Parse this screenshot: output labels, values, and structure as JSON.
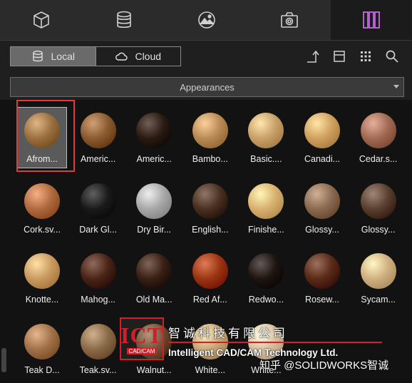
{
  "top_tabs": [
    {
      "name": "tab-parts",
      "icon": "cube-icon"
    },
    {
      "name": "tab-database",
      "icon": "database-icon"
    },
    {
      "name": "tab-environments",
      "icon": "landscape-icon"
    },
    {
      "name": "tab-camera",
      "icon": "camera-icon"
    },
    {
      "name": "tab-appearances",
      "icon": "columns-icon",
      "active": true
    }
  ],
  "source_toggle": {
    "local": "Local",
    "cloud": "Cloud",
    "selected": "Local"
  },
  "toolbar_icons": [
    "up-level-icon",
    "list-view-icon",
    "grid-view-icon",
    "search-icon"
  ],
  "dropdown": {
    "value": "Appearances"
  },
  "items": [
    {
      "label": "Afrom...",
      "color": "#9a7040",
      "selected": true
    },
    {
      "label": "Americ...",
      "color": "#8a5a30"
    },
    {
      "label": "Americ...",
      "color": "#2a1a12"
    },
    {
      "label": "Bambo...",
      "color": "#b88a55"
    },
    {
      "label": "Basic....",
      "color": "#c8a068"
    },
    {
      "label": "Canadi...",
      "color": "#d0a060"
    },
    {
      "label": "Cedar.s...",
      "color": "#a06a55"
    },
    {
      "label": "Cork.sv...",
      "color": "#b06a40"
    },
    {
      "label": "Dark Gl...",
      "color": "#1a1a1a"
    },
    {
      "label": "Dry Bir...",
      "color": "#a8a8a8"
    },
    {
      "label": "English...",
      "color": "#4a3020"
    },
    {
      "label": "Finishe...",
      "color": "#d8b070"
    },
    {
      "label": "Glossy...",
      "color": "#8a6a50"
    },
    {
      "label": "Glossy...",
      "color": "#5a4030"
    },
    {
      "label": "Knotte...",
      "color": "#c89a60"
    },
    {
      "label": "Mahog...",
      "color": "#4a2416"
    },
    {
      "label": "Old Ma...",
      "color": "#3a2014"
    },
    {
      "label": "Red Af...",
      "color": "#9a3512"
    },
    {
      "label": "Redwo...",
      "color": "#1e1410"
    },
    {
      "label": "Rosew...",
      "color": "#5a2a18"
    },
    {
      "label": "Sycam...",
      "color": "#d0b080"
    },
    {
      "label": "Teak D...",
      "color": "#a07048"
    },
    {
      "label": "Teak.sv...",
      "color": "#8a6a48"
    },
    {
      "label": "Walnut...",
      "color": "#6a4a30"
    },
    {
      "label": "White...",
      "color": "#c8a878"
    },
    {
      "label": "White...",
      "color": "#d8c0a0"
    }
  ],
  "watermark": {
    "logo_big": "ICT",
    "logo_small": "CAD/CAM",
    "company_cn": "智诚科技有限公司",
    "company_en": "Intelligent CAD/CAM Technology Ltd.",
    "credit": "知乎 @SOLIDWORKS智诚"
  }
}
